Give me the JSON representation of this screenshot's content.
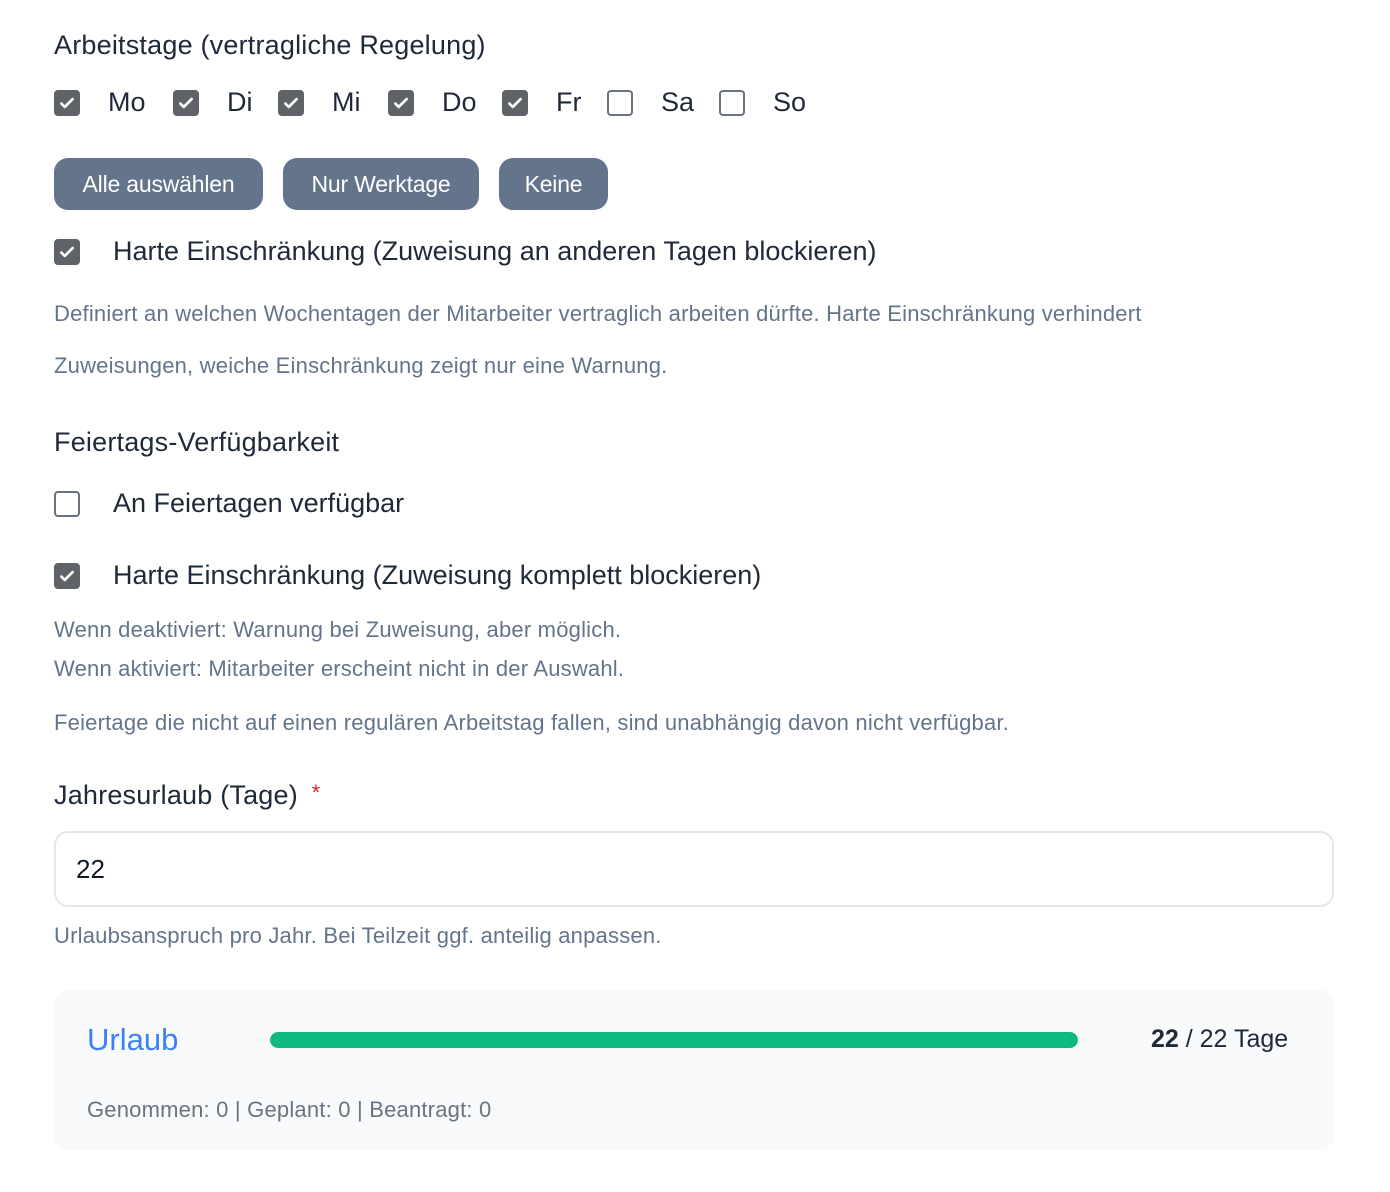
{
  "arbeitstage": {
    "title": "Arbeitstage (vertragliche Regelung)",
    "days": [
      {
        "label": "Mo",
        "checked": true
      },
      {
        "label": "Di",
        "checked": true
      },
      {
        "label": "Mi",
        "checked": true
      },
      {
        "label": "Do",
        "checked": true
      },
      {
        "label": "Fr",
        "checked": true
      },
      {
        "label": "Sa",
        "checked": false
      },
      {
        "label": "So",
        "checked": false
      }
    ],
    "buttons": {
      "all": "Alle auswählen",
      "workdays": "Nur Werktage",
      "none": "Keine"
    },
    "hard_restriction": {
      "label": "Harte Einschränkung (Zuweisung an anderen Tagen blockieren)",
      "checked": true
    },
    "help_line1": "Definiert an welchen Wochentagen der Mitarbeiter vertraglich arbeiten dürfte. Harte Einschränkung verhindert",
    "help_line2": "Zuweisungen, weiche Einschränkung zeigt nur eine Warnung."
  },
  "feiertage": {
    "title": "Feiertags-Verfügbarkeit",
    "available": {
      "label": "An Feiertagen verfügbar",
      "checked": false
    },
    "hard_restriction": {
      "label": "Harte Einschränkung (Zuweisung komplett blockieren)",
      "checked": true
    },
    "help_deactivated": "Wenn deaktiviert: Warnung bei Zuweisung, aber möglich.",
    "help_activated": "Wenn aktiviert: Mitarbeiter erscheint nicht in der Auswahl.",
    "help_note": "Feiertage die nicht auf einen regulären Arbeitstag fallen, sind unabhängig davon nicht verfügbar."
  },
  "jahresurlaub": {
    "label": "Jahresurlaub (Tage)",
    "required_marker": "*",
    "value": "22",
    "help": "Urlaubsanspruch pro Jahr. Bei Teilzeit ggf. anteilig anpassen."
  },
  "urlaub_card": {
    "title": "Urlaub",
    "remaining": "22",
    "total_text": "/ 22 Tage",
    "progress_fraction": 1.0,
    "stats": "Genommen: 0 | Geplant: 0 | Beantragt: 0",
    "colors": {
      "title": "#3b82f6",
      "bar": "#10b981"
    }
  }
}
